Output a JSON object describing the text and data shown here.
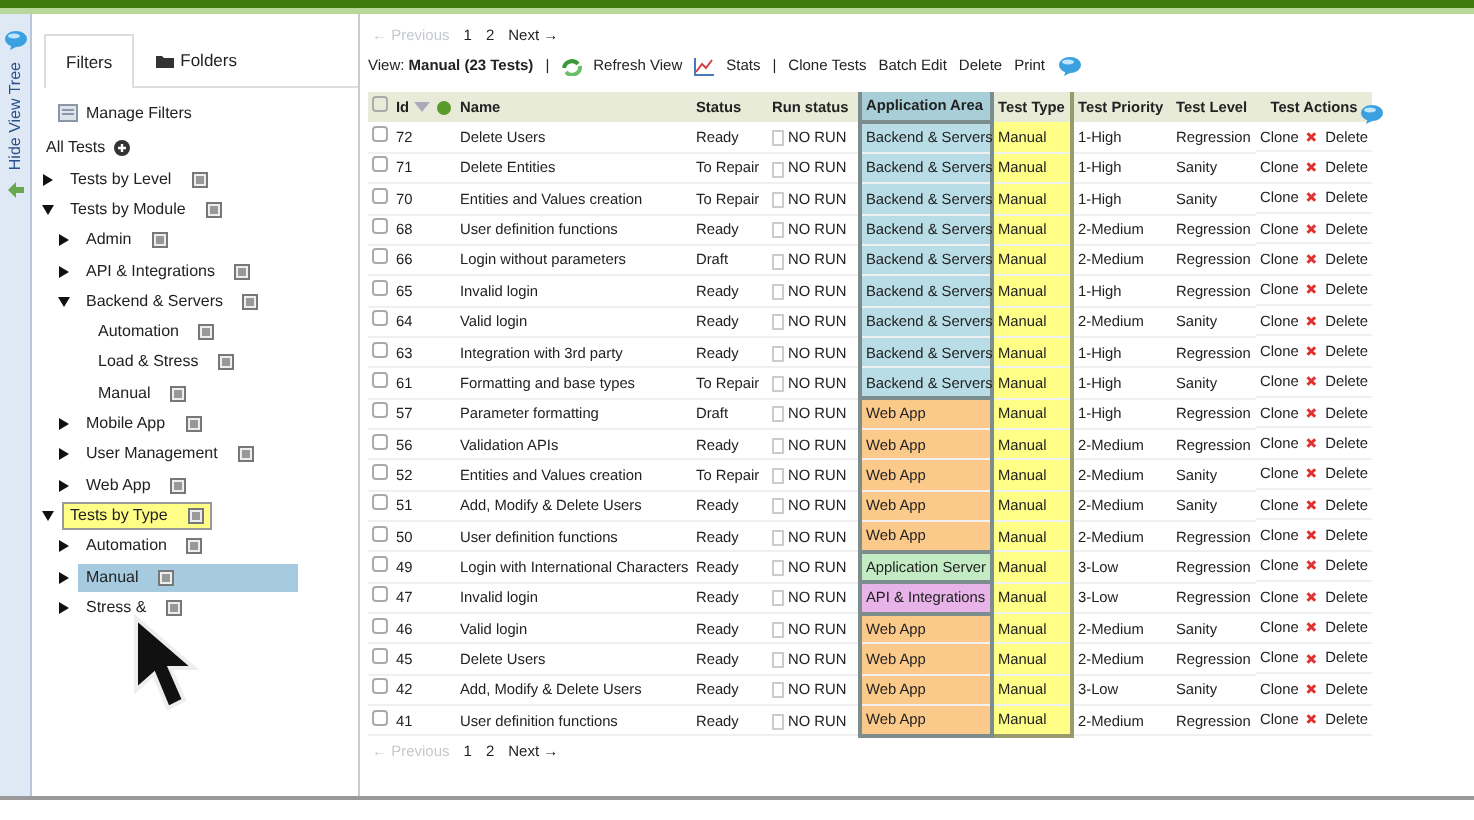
{
  "side_strip": {
    "label": "Hide View Tree"
  },
  "tabs": [
    {
      "label": "Filters",
      "selected": true,
      "kind": "filter"
    },
    {
      "label": "Folders",
      "selected": false,
      "kind": "folder"
    }
  ],
  "manage_filters": "Manage Filters",
  "tree_root": "All Tests",
  "tree": [
    {
      "label": "Tests by Level",
      "expanded": false,
      "highlighted": false,
      "selected": false
    },
    {
      "label": "Tests by Module",
      "expanded": true,
      "highlighted": false,
      "selected": false,
      "children": [
        {
          "label": "Admin",
          "expanded": false,
          "highlighted": false,
          "selected": false
        },
        {
          "label": "API & Integrations",
          "expanded": false,
          "highlighted": false,
          "selected": false
        },
        {
          "label": "Backend & Servers",
          "expanded": true,
          "highlighted": false,
          "selected": false,
          "children": [
            {
              "label": "Automation",
              "highlighted": false,
              "selected": false
            },
            {
              "label": "Load & Stress",
              "highlighted": false,
              "selected": false
            },
            {
              "label": "Manual",
              "highlighted": false,
              "selected": false
            }
          ]
        },
        {
          "label": "Mobile App",
          "expanded": false,
          "highlighted": false,
          "selected": false
        },
        {
          "label": "User Management",
          "expanded": false,
          "highlighted": false,
          "selected": false
        },
        {
          "label": "Web App",
          "expanded": false,
          "highlighted": false,
          "selected": false
        }
      ]
    },
    {
      "label": "Tests by Type",
      "expanded": true,
      "highlighted": true,
      "selected": false,
      "children": [
        {
          "label": "Automation",
          "expanded": false,
          "highlighted": false,
          "selected": false
        },
        {
          "label": "Manual",
          "expanded": false,
          "highlighted": false,
          "selected": true
        },
        {
          "label": "Stress &",
          "expanded": false,
          "highlighted": false,
          "selected": false
        }
      ]
    }
  ],
  "pagination": {
    "previous": "← Previous",
    "pages": [
      "1",
      "2"
    ],
    "next": "Next →"
  },
  "toolbar": {
    "view_label": "View:",
    "view_name": "Manual (23 Tests)",
    "separator": "|",
    "refresh": "Refresh View",
    "stats": "Stats",
    "clone": "Clone Tests",
    "batch_edit": "Batch Edit",
    "delete": "Delete",
    "print": "Print"
  },
  "select_all": {
    "checked": false
  },
  "columns": [
    "Id",
    "Name",
    "Status",
    "Run status",
    "Application Area",
    "Test Type",
    "Test Priority",
    "Test Level",
    "Test Actions"
  ],
  "rows": [
    {
      "checked": false,
      "id": "72",
      "name": "Delete Users",
      "status": "Ready",
      "run": "NO RUN",
      "area": "Backend & Servers",
      "color": "#b9dde6",
      "type": "Manual",
      "priority": "1-High",
      "level": "Regression",
      "clone": "Clone",
      "delete": "Delete"
    },
    {
      "checked": false,
      "id": "71",
      "name": "Delete Entities",
      "status": "To Repair",
      "run": "NO RUN",
      "area": "Backend & Servers",
      "color": "#b9dde6",
      "type": "Manual",
      "priority": "1-High",
      "level": "Sanity",
      "clone": "Clone",
      "delete": "Delete"
    },
    {
      "checked": false,
      "id": "70",
      "name": "Entities and Values creation",
      "status": "To Repair",
      "run": "NO RUN",
      "area": "Backend & Servers",
      "color": "#b9dde6",
      "type": "Manual",
      "priority": "1-High",
      "level": "Sanity",
      "clone": "Clone",
      "delete": "Delete"
    },
    {
      "checked": false,
      "id": "68",
      "name": "User definition functions",
      "status": "Ready",
      "run": "NO RUN",
      "area": "Backend & Servers",
      "color": "#b9dde6",
      "type": "Manual",
      "priority": "2-Medium",
      "level": "Regression",
      "clone": "Clone",
      "delete": "Delete"
    },
    {
      "checked": false,
      "id": "66",
      "name": "Login without parameters",
      "status": "Draft",
      "run": "NO RUN",
      "area": "Backend & Servers",
      "color": "#b9dde6",
      "type": "Manual",
      "priority": "2-Medium",
      "level": "Regression",
      "clone": "Clone",
      "delete": "Delete"
    },
    {
      "checked": false,
      "id": "65",
      "name": "Invalid login",
      "status": "Ready",
      "run": "NO RUN",
      "area": "Backend & Servers",
      "color": "#b9dde6",
      "type": "Manual",
      "priority": "1-High",
      "level": "Regression",
      "clone": "Clone",
      "delete": "Delete"
    },
    {
      "checked": false,
      "id": "64",
      "name": "Valid login",
      "status": "Ready",
      "run": "NO RUN",
      "area": "Backend & Servers",
      "color": "#b9dde6",
      "type": "Manual",
      "priority": "2-Medium",
      "level": "Sanity",
      "clone": "Clone",
      "delete": "Delete"
    },
    {
      "checked": false,
      "id": "63",
      "name": "Integration with 3rd party",
      "status": "Ready",
      "run": "NO RUN",
      "area": "Backend & Servers",
      "color": "#b9dde6",
      "type": "Manual",
      "priority": "1-High",
      "level": "Regression",
      "clone": "Clone",
      "delete": "Delete"
    },
    {
      "checked": false,
      "id": "61",
      "name": "Formatting and base types",
      "status": "To Repair",
      "run": "NO RUN",
      "area": "Backend & Servers",
      "color": "#b9dde6",
      "type": "Manual",
      "priority": "1-High",
      "level": "Sanity",
      "clone": "Clone",
      "delete": "Delete"
    },
    {
      "checked": false,
      "id": "57",
      "name": "Parameter formatting",
      "status": "Draft",
      "run": "NO RUN",
      "area": "Web App",
      "color": "#fbc98a",
      "type": "Manual",
      "priority": "1-High",
      "level": "Regression",
      "clone": "Clone",
      "delete": "Delete"
    },
    {
      "checked": false,
      "id": "56",
      "name": "Validation APIs",
      "status": "Ready",
      "run": "NO RUN",
      "area": "Web App",
      "color": "#fbc98a",
      "type": "Manual",
      "priority": "2-Medium",
      "level": "Regression",
      "clone": "Clone",
      "delete": "Delete"
    },
    {
      "checked": false,
      "id": "52",
      "name": "Entities and Values creation",
      "status": "To Repair",
      "run": "NO RUN",
      "area": "Web App",
      "color": "#fbc98a",
      "type": "Manual",
      "priority": "2-Medium",
      "level": "Sanity",
      "clone": "Clone",
      "delete": "Delete"
    },
    {
      "checked": false,
      "id": "51",
      "name": "Add, Modify & Delete Users",
      "status": "Ready",
      "run": "NO RUN",
      "area": "Web App",
      "color": "#fbc98a",
      "type": "Manual",
      "priority": "2-Medium",
      "level": "Sanity",
      "clone": "Clone",
      "delete": "Delete"
    },
    {
      "checked": false,
      "id": "50",
      "name": "User definition functions",
      "status": "Ready",
      "run": "NO RUN",
      "area": "Web App",
      "color": "#fbc98a",
      "type": "Manual",
      "priority": "2-Medium",
      "level": "Regression",
      "clone": "Clone",
      "delete": "Delete"
    },
    {
      "checked": false,
      "id": "49",
      "name": "Login with International Characters",
      "status": "Ready",
      "run": "NO RUN",
      "area": "Application Server",
      "color": "#c4ecc4",
      "type": "Manual",
      "priority": "3-Low",
      "level": "Regression",
      "clone": "Clone",
      "delete": "Delete"
    },
    {
      "checked": false,
      "id": "47",
      "name": "Invalid login",
      "status": "Ready",
      "run": "NO RUN",
      "area": "API & Integrations",
      "color": "#e7b3e8",
      "type": "Manual",
      "priority": "3-Low",
      "level": "Regression",
      "clone": "Clone",
      "delete": "Delete"
    },
    {
      "checked": false,
      "id": "46",
      "name": "Valid login",
      "status": "Ready",
      "run": "NO RUN",
      "area": "Web App",
      "color": "#fbc98a",
      "type": "Manual",
      "priority": "2-Medium",
      "level": "Sanity",
      "clone": "Clone",
      "delete": "Delete"
    },
    {
      "checked": false,
      "id": "45",
      "name": "Delete Users",
      "status": "Ready",
      "run": "NO RUN",
      "area": "Web App",
      "color": "#fbc98a",
      "type": "Manual",
      "priority": "2-Medium",
      "level": "Regression",
      "clone": "Clone",
      "delete": "Delete"
    },
    {
      "checked": false,
      "id": "42",
      "name": "Add, Modify & Delete Users",
      "status": "Ready",
      "run": "NO RUN",
      "area": "Web App",
      "color": "#fbc98a",
      "type": "Manual",
      "priority": "3-Low",
      "level": "Sanity",
      "clone": "Clone",
      "delete": "Delete"
    },
    {
      "checked": false,
      "id": "41",
      "name": "User definition functions",
      "status": "Ready",
      "run": "NO RUN",
      "area": "Web App",
      "color": "#fbc98a",
      "type": "Manual",
      "priority": "2-Medium",
      "level": "Regression",
      "clone": "Clone",
      "delete": "Delete"
    }
  ],
  "pagination_bottom": {
    "previous": "← Previous",
    "pages": [
      "1",
      "2"
    ],
    "next": "Next →"
  }
}
